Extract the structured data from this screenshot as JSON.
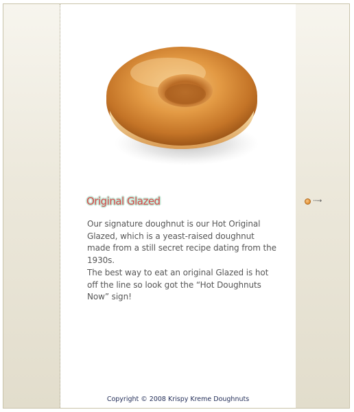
{
  "product": {
    "image_alt": "Original Glazed doughnut",
    "heading": "Original Glazed",
    "paragraphs": [
      "Our signature doughnut is our Hot Original Glazed, which is a yeast-raised doughnut made from a still secret recipe dating from the 1930s.",
      "The best way to eat an original Glazed is hot off the line so look got the “Hot Doughnuts Now” sign!"
    ]
  },
  "navigation": {
    "next_icon": "orange-dot-arrow-icon"
  },
  "footer": {
    "copyright": "Copyright © 2008 Krispy Kreme Doughnuts"
  },
  "colors": {
    "heading": "#d84a4a",
    "heading_outline": "#bfe3d2",
    "body_text": "#555555",
    "footer_text": "#1f2a55",
    "side_panel": "#ece8db",
    "accent_orange": "#e5953a"
  }
}
